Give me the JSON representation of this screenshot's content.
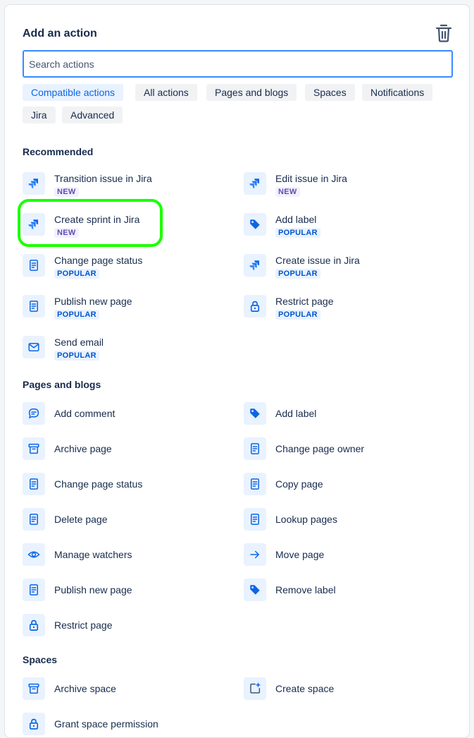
{
  "header": {
    "title": "Add an action",
    "delete_icon": "trash-icon"
  },
  "search": {
    "placeholder": "Search actions",
    "value": ""
  },
  "filters": [
    {
      "label": "Compatible actions",
      "active": true
    },
    {
      "label": "All actions",
      "active": false
    },
    {
      "label": "Pages and blogs",
      "active": false
    },
    {
      "label": "Spaces",
      "active": false
    },
    {
      "label": "Notifications",
      "active": false
    },
    {
      "label": "Jira",
      "active": false
    },
    {
      "label": "Advanced",
      "active": false
    }
  ],
  "sections": {
    "recommended": {
      "title": "Recommended",
      "items": [
        {
          "label": "Transition issue in Jira",
          "badge": "NEW",
          "icon": "jira-icon"
        },
        {
          "label": "Edit issue in Jira",
          "badge": "NEW",
          "icon": "jira-icon"
        },
        {
          "label": "Create sprint in Jira",
          "badge": "NEW",
          "icon": "jira-icon"
        },
        {
          "label": "Add label",
          "badge": "POPULAR",
          "icon": "tag-icon"
        },
        {
          "label": "Change page status",
          "badge": "POPULAR",
          "icon": "page-icon"
        },
        {
          "label": "Create issue in Jira",
          "badge": "POPULAR",
          "icon": "jira-icon"
        },
        {
          "label": "Publish new page",
          "badge": "POPULAR",
          "icon": "page-icon"
        },
        {
          "label": "Restrict page",
          "badge": "POPULAR",
          "icon": "lock-icon"
        },
        {
          "label": "Send email",
          "badge": "POPULAR",
          "icon": "email-icon"
        }
      ]
    },
    "pages_and_blogs": {
      "title": "Pages and blogs",
      "items": [
        {
          "label": "Add comment",
          "icon": "comment-icon"
        },
        {
          "label": "Add label",
          "icon": "tag-icon"
        },
        {
          "label": "Archive page",
          "icon": "archive-icon"
        },
        {
          "label": "Change page owner",
          "icon": "page-icon"
        },
        {
          "label": "Change page status",
          "icon": "page-icon"
        },
        {
          "label": "Copy page",
          "icon": "page-icon"
        },
        {
          "label": "Delete page",
          "icon": "page-icon"
        },
        {
          "label": "Lookup pages",
          "icon": "page-icon"
        },
        {
          "label": "Manage watchers",
          "icon": "eye-icon"
        },
        {
          "label": "Move page",
          "icon": "arrow-right-icon"
        },
        {
          "label": "Publish new page",
          "icon": "page-icon"
        },
        {
          "label": "Remove label",
          "icon": "tag-icon"
        },
        {
          "label": "Restrict page",
          "icon": "lock-icon"
        }
      ]
    },
    "spaces": {
      "title": "Spaces",
      "items": [
        {
          "label": "Archive space",
          "icon": "archive-icon"
        },
        {
          "label": "Create space",
          "icon": "add-space-icon"
        },
        {
          "label": "Grant space permission",
          "icon": "lock-icon"
        }
      ]
    }
  },
  "colors": {
    "accent": "#0c66e4",
    "icon_bg": "#e9f2ff",
    "highlight": "#1aff00"
  }
}
